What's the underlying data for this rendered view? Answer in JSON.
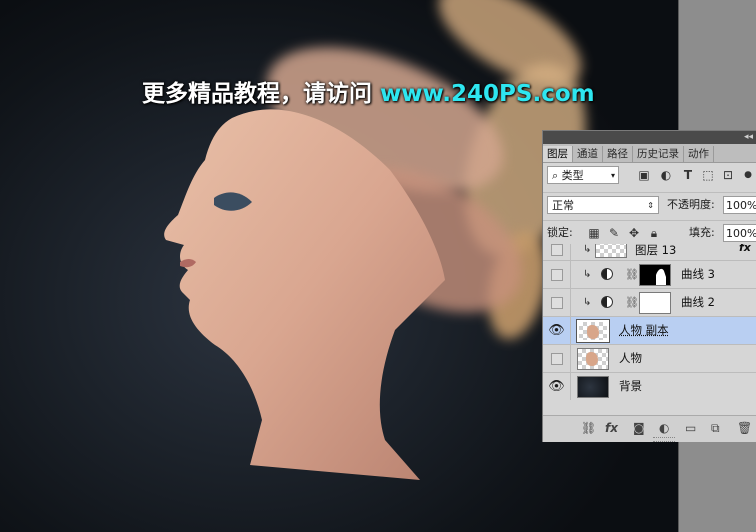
{
  "watermark": {
    "text_cn": "更多精品教程，请访问",
    "text_url": "www.240PS.com"
  },
  "panel": {
    "tabs": [
      "图层",
      "通道",
      "路径",
      "历史记录",
      "动作"
    ],
    "active_tab": "图层",
    "filter": {
      "search_icon": "⌕",
      "kind_label": "类型"
    },
    "blend_mode": "正常",
    "opacity_label": "不透明度:",
    "opacity_value": "100%",
    "lock_label": "锁定:",
    "fill_label": "填充:",
    "fill_value": "100%",
    "layers": [
      {
        "name": "图层 13",
        "visible": false,
        "type": "raster",
        "has_fx": true,
        "fx_label": "fx"
      },
      {
        "name": "曲线 3",
        "visible": false,
        "type": "curves"
      },
      {
        "name": "曲线 2",
        "visible": false,
        "type": "curves"
      },
      {
        "name": "人物 副本",
        "visible": true,
        "type": "raster",
        "selected": true
      },
      {
        "name": "人物",
        "visible": false,
        "type": "raster"
      },
      {
        "name": "背景",
        "visible": true,
        "type": "background"
      }
    ]
  },
  "colors": {
    "selected_row": "#b9cff2",
    "watermark_url": "#2ee6f0"
  }
}
